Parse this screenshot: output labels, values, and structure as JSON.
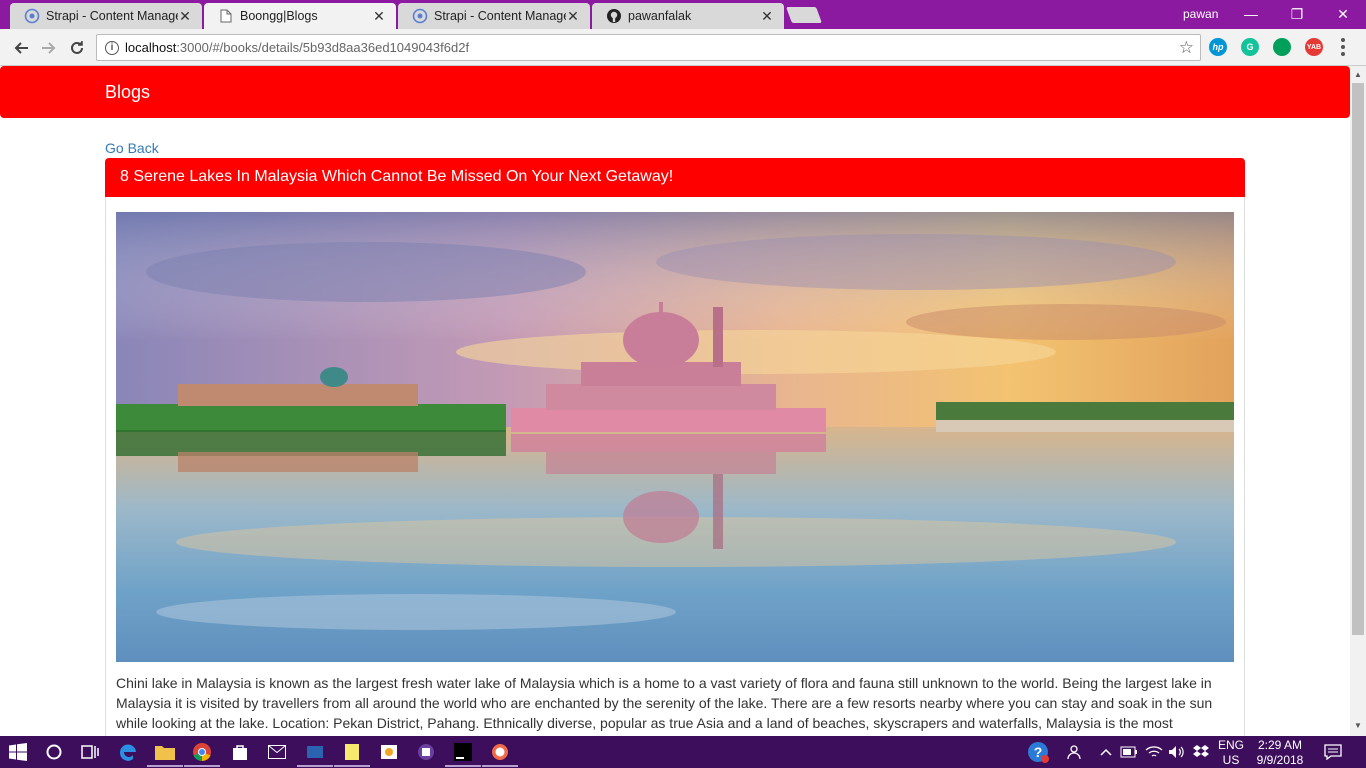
{
  "browser": {
    "tabs": [
      {
        "title": "Strapi - Content Manager",
        "icon": "strapi-icon",
        "active": false
      },
      {
        "title": "Boongg|Blogs",
        "icon": "page-icon",
        "active": true
      },
      {
        "title": "Strapi - Content Manager",
        "icon": "strapi-icon",
        "active": false
      },
      {
        "title": "pawanfalak",
        "icon": "github-icon",
        "active": false
      }
    ],
    "close_glyph": "✕",
    "profile_name": "pawan",
    "url_host": "localhost",
    "url_rest": ":3000/#/books/details/5b93d8aa36ed1049043f6d2f",
    "extensions": [
      {
        "name": "hp-extension-icon",
        "label": "hp",
        "color": "#0096d6"
      },
      {
        "name": "grammarly-icon",
        "label": "G",
        "color": "#15c39a"
      },
      {
        "name": "chat-extension-icon",
        "label": "",
        "color": "#00a05a"
      },
      {
        "name": "yab-extension-icon",
        "label": "YAB",
        "color": "#e53935"
      }
    ]
  },
  "page": {
    "navbar": {
      "brand": "Blogs",
      "color": "#ff0000"
    },
    "go_back": "Go Back",
    "blog": {
      "title": "8 Serene Lakes In Malaysia Which Cannot Be Missed On Your Next Getaway!",
      "body": "Chini lake in Malaysia is known as the largest fresh water lake of Malaysia which is a home to a vast variety of flora and fauna still unknown to the world. Being the largest lake in Malaysia it is visited by travellers from all around the world who are enchanted by the serenity of the lake. There are a few resorts nearby where you can stay and soak in the sun while looking at the lake. Location: Pekan District, Pahang. Ethnically diverse, popular as true Asia and a land of beaches, skyscrapers and waterfalls, Malaysia is the most"
    }
  },
  "taskbar": {
    "language": "ENG",
    "region": "US",
    "time": "2:29 AM",
    "date": "9/9/2018"
  }
}
